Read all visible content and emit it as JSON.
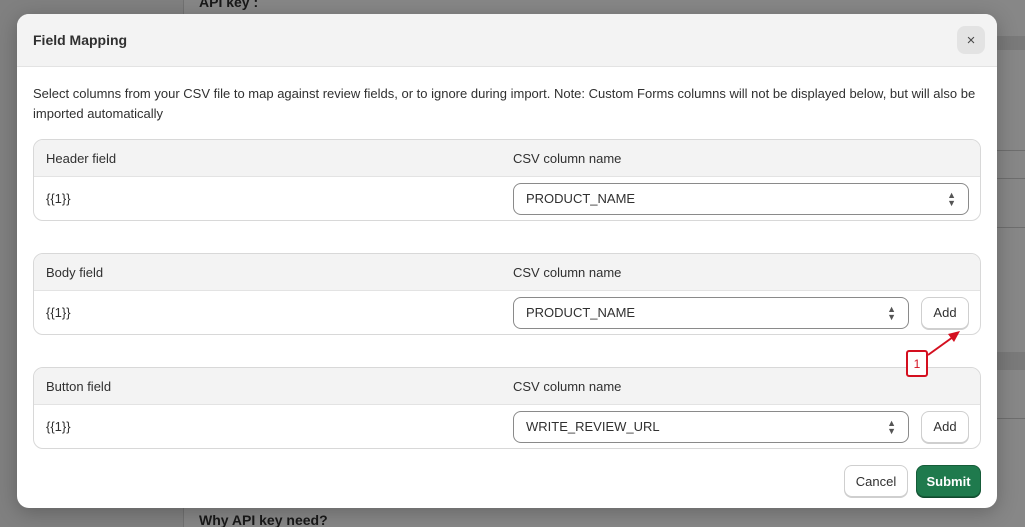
{
  "background": {
    "top_label": "API key :",
    "bottom_label": "Why API key need?"
  },
  "modal": {
    "title": "Field Mapping",
    "close_symbol": "×",
    "description": "Select columns from your CSV file to map against review fields, or to ignore during import. Note: Custom Forms columns will not be displayed below, but will also be imported automatically"
  },
  "sections": [
    {
      "field_header": "Header field",
      "csv_header": "CSV column name",
      "field_value": "{{1}}",
      "selected_column": "PRODUCT_NAME",
      "has_add": false
    },
    {
      "field_header": "Body field",
      "csv_header": "CSV column name",
      "field_value": "{{1}}",
      "selected_column": "PRODUCT_NAME",
      "has_add": true,
      "add_label": "Add"
    },
    {
      "field_header": "Button field",
      "csv_header": "CSV column name",
      "field_value": "{{1}}",
      "selected_column": "WRITE_REVIEW_URL",
      "has_add": true,
      "add_label": "Add"
    }
  ],
  "footer": {
    "cancel_label": "Cancel",
    "submit_label": "Submit"
  },
  "annotation": {
    "label": "1",
    "color": "#d40f1f"
  },
  "colors": {
    "primary": "#1f7a4d",
    "overlay": "rgba(0,0,0,0.47)"
  }
}
